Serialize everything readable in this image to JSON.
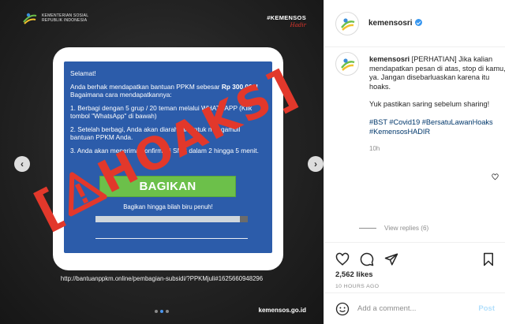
{
  "image": {
    "logo": {
      "line1": "KEMENTERIAN SOSIAL",
      "line2": "REPUBLIK INDONESIA"
    },
    "tag": {
      "main": "#KEMENSOS",
      "sub": "Hadir"
    },
    "message": {
      "greeting": "Selamat!",
      "p1_a": "Anda berhak mendapatkan bantuan PPKM sebesar ",
      "p1_amount": "Rp 300.000!",
      "p1_b": " Bagaimana cara mendapatkannya:",
      "step1": "1. Berbagi dengan 5 grup / 20 teman melalui WHATSAPP (Klik tombol \"WhatsApp\" di bawah)",
      "step2": "2. Setelah berbagi, Anda akan diarahkan untuk mengambil bantuan PPKM Anda.",
      "step3": "3. Anda akan menerima konfirmasi SMS dalam 2 hingga 5 menit.",
      "button": "BAGIKAN",
      "under_button": "Bagikan hingga bilah biru penuh!",
      "progress": 0.95
    },
    "stamp": "HOAKS",
    "url": "http://bantuanppkm.online/pembagian-subsidi/?PPKMjuli#1625660948296",
    "domain": "kemensos.go.id",
    "nav": {
      "prev": "‹",
      "next": "›"
    },
    "dots": 3,
    "active_dot": 1,
    "colors": {
      "screen": "#2c5caa",
      "stamp": "#e2382b",
      "button": "#6cc04a"
    }
  },
  "header": {
    "username": "kemensosri"
  },
  "caption": {
    "username": "kemensosri",
    "text1": "[PERHATIAN] Jika kalian mendapatkan pesan di atas, stop di kamu, ya. Jangan disebarluaskan karena itu hoaks.",
    "text2": "Yuk pastikan saring sebelum sharing!",
    "hashtags": "#BST #Covid19 #BersatuLawanHoaks #KemensosHADIR",
    "age": "10h"
  },
  "view_replies": "View replies (6)",
  "likes": "2,562 likes",
  "post_time": "10 HOURS AGO",
  "comment": {
    "placeholder": "Add a comment...",
    "post": "Post"
  },
  "icons": [
    "heart-icon",
    "comment-icon",
    "share-icon",
    "bookmark-icon",
    "emoji-icon",
    "small-heart-icon",
    "verified-icon",
    "warning-icon"
  ]
}
